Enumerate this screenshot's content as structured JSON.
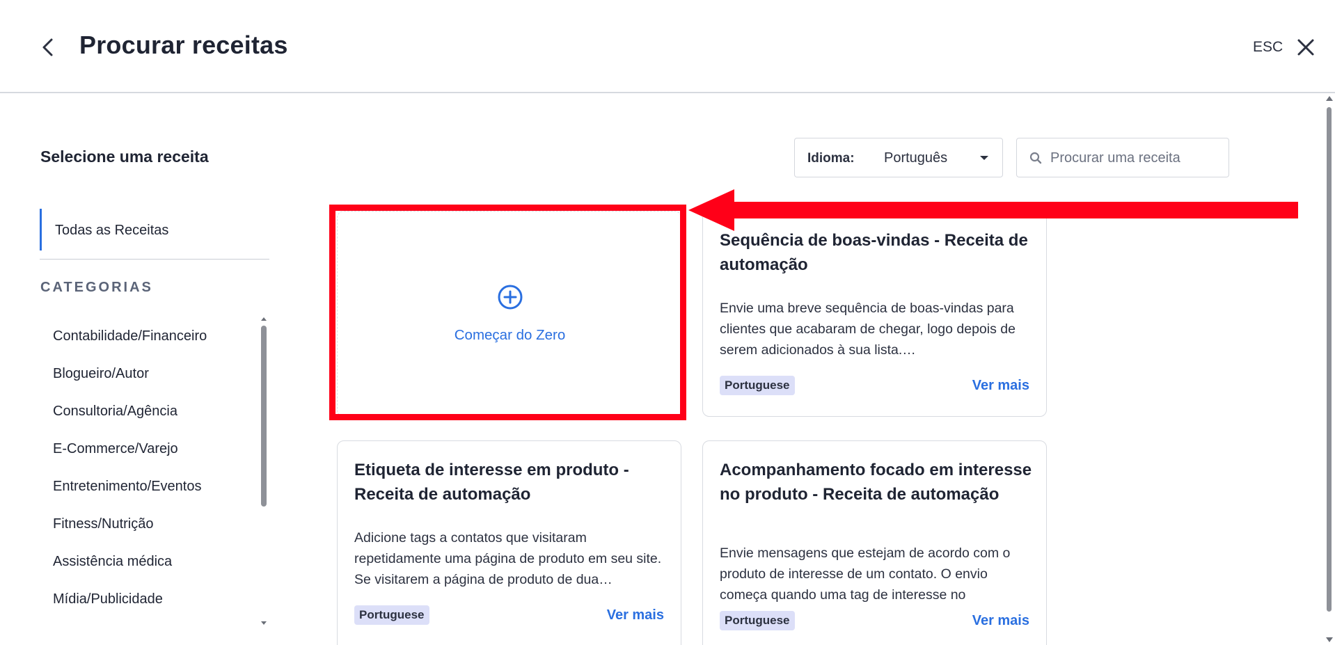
{
  "header": {
    "title": "Procurar receitas",
    "esc_label": "ESC"
  },
  "sidebar": {
    "heading": "Selecione uma receita",
    "all_recipes_label": "Todas as Receitas",
    "categories_heading": "CATEGORIAS",
    "categories": [
      "Contabilidade/Financeiro",
      "Blogueiro/Autor",
      "Consultoria/Agência",
      "E-Commerce/Varejo",
      "Entretenimento/Eventos",
      "Fitness/Nutrição",
      "Assistência médica",
      "Mídia/Publicidade"
    ]
  },
  "toolbar": {
    "language_label": "Idioma:",
    "language_value": "Português",
    "search_placeholder": "Procurar uma receita"
  },
  "start_card": {
    "label": "Começar do Zero"
  },
  "cards": [
    {
      "title": "Sequência de boas-vindas - Receita de automação",
      "description": "Envie uma breve sequência de boas-vindas para clientes que acabaram de chegar, logo depois de serem adicionados à sua lista.…",
      "badge": "Portuguese",
      "link": "Ver mais"
    },
    {
      "title": "Etiqueta de interesse em produto - Receita de automação",
      "description": "Adicione tags a contatos que visitaram repetidamente uma página de produto em seu site. Se visitarem a página de produto de dua…",
      "badge": "Portuguese",
      "link": "Ver mais"
    },
    {
      "title": "Acompanhamento focado em interesse no produto - Receita de automação",
      "description": "Envie mensagens que estejam de acordo com o produto de interesse de um contato. O envio começa quando uma tag de interesse no",
      "badge": "Portuguese",
      "link": "Ver mais"
    }
  ],
  "colors": {
    "accent": "#2a6fe0",
    "annotation_red": "#ff0018",
    "badge_bg": "#dcdff8"
  },
  "icons": {
    "back": "chevron-left-icon",
    "close": "close-icon",
    "search": "search-icon",
    "add": "plus-circle-icon",
    "dropdown": "caret-down-icon"
  }
}
